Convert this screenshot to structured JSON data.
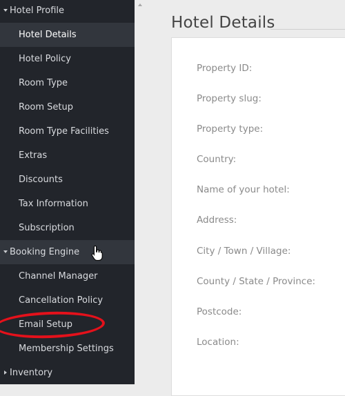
{
  "sidebar": {
    "items": [
      {
        "label": "Hotel Profile"
      },
      {
        "label": "Hotel Details"
      },
      {
        "label": "Hotel Policy"
      },
      {
        "label": "Room Type"
      },
      {
        "label": "Room Setup"
      },
      {
        "label": "Room Type Facilities"
      },
      {
        "label": "Extras"
      },
      {
        "label": "Discounts"
      },
      {
        "label": "Tax Information"
      },
      {
        "label": "Subscription"
      },
      {
        "label": "Booking Engine"
      },
      {
        "label": "Channel Manager"
      },
      {
        "label": "Cancellation Policy"
      },
      {
        "label": "Email Setup"
      },
      {
        "label": "Membership Settings"
      },
      {
        "label": "Inventory"
      }
    ]
  },
  "main": {
    "title": "Hotel Details",
    "fields": [
      {
        "label": "Property ID:"
      },
      {
        "label": "Property slug:"
      },
      {
        "label": "Property type:"
      },
      {
        "label": "Country:"
      },
      {
        "label": "Name of your hotel:"
      },
      {
        "label": "Address:"
      },
      {
        "label": "City / Town / Village:"
      },
      {
        "label": "County / State / Province:"
      },
      {
        "label": "Postcode:"
      },
      {
        "label": "Location:"
      }
    ]
  },
  "colors": {
    "sidebar_bg": "#22252b",
    "active_bg": "#32363d",
    "annotation": "#e4111b"
  }
}
